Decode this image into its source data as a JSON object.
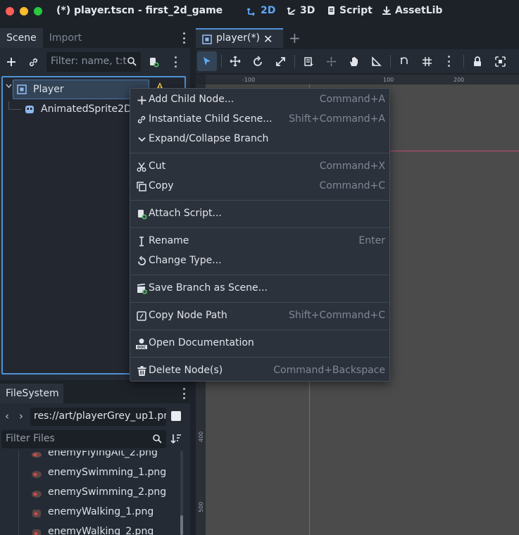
{
  "window": {
    "title": "(*) player.tscn - first_2d_game",
    "workspaces": [
      {
        "label": "2D",
        "icon": "2d-icon",
        "active": true
      },
      {
        "label": "3D",
        "icon": "3d-icon",
        "active": false
      },
      {
        "label": "Script",
        "icon": "script-icon",
        "active": false
      },
      {
        "label": "AssetLib",
        "icon": "assetlib-icon",
        "active": false
      }
    ]
  },
  "scene_dock": {
    "tabs": [
      "Scene",
      "Import"
    ],
    "filter_placeholder": "Filter: name, t:t",
    "tree": [
      {
        "label": "Player",
        "icon": "node2d-icon",
        "selected": true
      },
      {
        "label": "AnimatedSprite2D",
        "icon": "animated-sprite-icon",
        "selected": false
      }
    ]
  },
  "filesystem": {
    "tab": "FileSystem",
    "path": "res://art/playerGrey_up1.pn",
    "filter_placeholder": "Filter Files",
    "files": [
      "enemyFlyingAlt_2.png",
      "enemySwimming_1.png",
      "enemySwimming_2.png",
      "enemyWalking_1.png",
      "enemyWalking_2.png"
    ]
  },
  "editor": {
    "tab_label": "player(*)",
    "ruler_top": [
      "-100",
      "100",
      "200"
    ],
    "ruler_left": [
      "400",
      "500"
    ]
  },
  "context_menu": {
    "items": [
      {
        "label": "Add Child Node...",
        "shortcut": "Command+A",
        "icon": "add-icon"
      },
      {
        "label": "Instantiate Child Scene...",
        "shortcut": "Shift+Command+A",
        "icon": "link-icon"
      },
      {
        "label": "Expand/Collapse Branch",
        "shortcut": "",
        "icon": "chevron-down-icon"
      },
      {
        "label": "Cut",
        "shortcut": "Command+X",
        "icon": "scissors-icon"
      },
      {
        "label": "Copy",
        "shortcut": "Command+C",
        "icon": "copy-icon"
      },
      {
        "label": "Attach Script...",
        "shortcut": "",
        "icon": "attach-script-icon"
      },
      {
        "label": "Rename",
        "shortcut": "Enter",
        "icon": "text-cursor-icon"
      },
      {
        "label": "Change Type...",
        "shortcut": "",
        "icon": "rotate-icon"
      },
      {
        "label": "Save Branch as Scene...",
        "shortcut": "",
        "icon": "save-branch-icon"
      },
      {
        "label": "Copy Node Path",
        "shortcut": "Shift+Command+C",
        "icon": "node-path-icon"
      },
      {
        "label": "Open Documentation",
        "shortcut": "",
        "icon": "doc-icon"
      },
      {
        "label": "Delete Node(s)",
        "shortcut": "Command+Backspace",
        "icon": "trash-icon"
      }
    ]
  }
}
